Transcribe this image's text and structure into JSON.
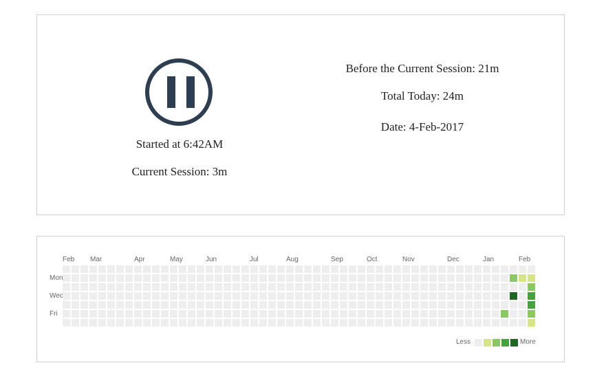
{
  "session": {
    "pause_icon": "pause-icon",
    "started_at": "Started at 6:42AM",
    "current_session": "Current Session: 3m",
    "before_session": "Before the Current Session: 21m",
    "total_today": "Total Today: 24m",
    "date": "Date: 4-Feb-2017"
  },
  "calendar": {
    "months": [
      "Feb",
      "Mar",
      "Apr",
      "May",
      "Jun",
      "Jul",
      "Aug",
      "Sep",
      "Oct",
      "Nov",
      "Dec",
      "Jan",
      "Feb"
    ],
    "day_labels": [
      "Mon",
      "Wed",
      "Fri"
    ],
    "weeks": 53,
    "empty_color": "#eeeeee",
    "levels": [
      "#eeeeee",
      "#d6e685",
      "#8cc665",
      "#44a340",
      "#1e6823"
    ],
    "activity": [
      {
        "week": 50,
        "day": 1,
        "level": 2
      },
      {
        "week": 50,
        "day": 3,
        "level": 4
      },
      {
        "week": 49,
        "day": 5,
        "level": 2
      },
      {
        "week": 51,
        "day": 1,
        "level": 1
      },
      {
        "week": 52,
        "day": 1,
        "level": 1
      },
      {
        "week": 52,
        "day": 2,
        "level": 2
      },
      {
        "week": 52,
        "day": 3,
        "level": 3
      },
      {
        "week": 52,
        "day": 4,
        "level": 3
      },
      {
        "week": 52,
        "day": 5,
        "level": 2
      },
      {
        "week": 52,
        "day": 6,
        "level": 1
      }
    ],
    "legend": {
      "less": "Less",
      "more": "More"
    }
  }
}
